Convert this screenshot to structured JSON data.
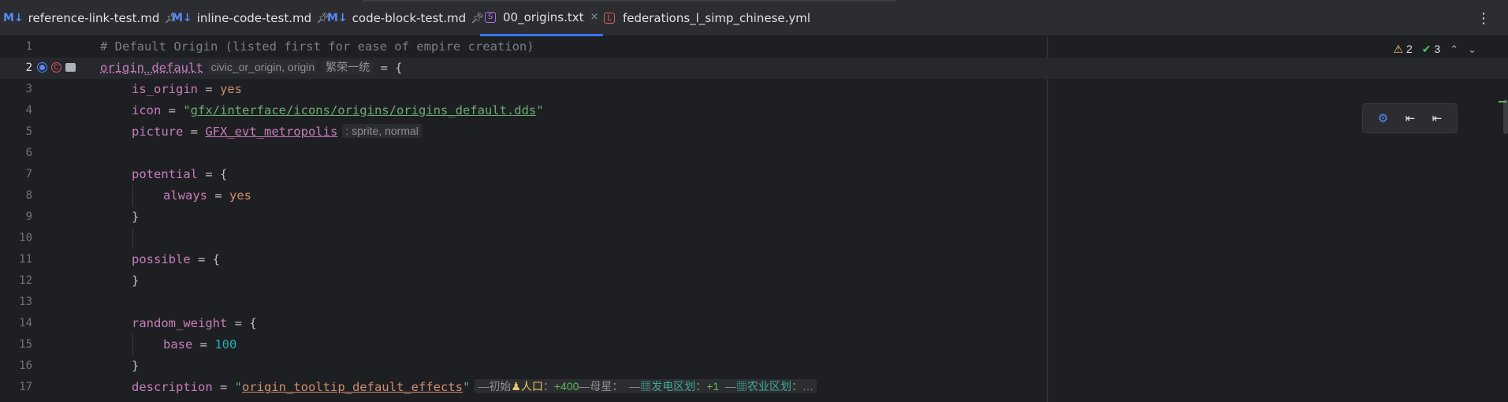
{
  "tabs": [
    {
      "icon": "M↓",
      "label": "reference-link-test.md",
      "pinned": true
    },
    {
      "icon": "M↓",
      "label": "inline-code-test.md",
      "pinned": true
    },
    {
      "icon": "M↓",
      "label": "code-block-test.md",
      "pinned": true
    },
    {
      "icon": "S",
      "label": "00_origins.txt",
      "active": true,
      "close": "×"
    },
    {
      "icon": "L",
      "label": "federations_l_simp_chinese.yml"
    }
  ],
  "more_menu": "⋮",
  "inspections": {
    "warnings": "2",
    "ok": "3",
    "up": "⌃",
    "down": "⌄"
  },
  "lines": {
    "l1": {
      "num": "1",
      "text": "# Default Origin (listed first for ease of empire creation)"
    },
    "l2": {
      "num": "2",
      "name": "origin_default",
      "hint_type": "civic_or_origin, origin",
      "hint_loc": "繁荣一统",
      "rest": " = {"
    },
    "l3": {
      "num": "3",
      "key": "is_origin",
      "op": " = ",
      "val": "yes"
    },
    "l4": {
      "num": "4",
      "key": "icon",
      "op": " = ",
      "q1": "\"",
      "path": "gfx/interface/icons/origins/origins_default.dds",
      "q2": "\""
    },
    "l5": {
      "num": "5",
      "key": "picture",
      "op": " = ",
      "val": "GFX_evt_metropolis",
      "hint": ": sprite, normal"
    },
    "l6": {
      "num": "6"
    },
    "l7": {
      "num": "7",
      "key": "potential",
      "op": " = {"
    },
    "l8": {
      "num": "8",
      "key": "always",
      "op": " = ",
      "val": "yes"
    },
    "l9": {
      "num": "9",
      "text": "}"
    },
    "l10": {
      "num": "10"
    },
    "l11": {
      "num": "11",
      "key": "possible",
      "op": " = {"
    },
    "l12": {
      "num": "12",
      "text": "}"
    },
    "l13": {
      "num": "13"
    },
    "l14": {
      "num": "14",
      "key": "random_weight",
      "op": " = {"
    },
    "l15": {
      "num": "15",
      "key": "base",
      "op": " = ",
      "val": "100"
    },
    "l16": {
      "num": "16",
      "text": "}"
    },
    "l17": {
      "num": "17",
      "key": "description",
      "op": " = ",
      "q1": "\"",
      "val": "origin_tooltip_default_effects",
      "q2": "\"",
      "hint_a": "—初始",
      "hint_b": "人口",
      "hint_c": "：",
      "hint_d": "+400",
      "hint_e": "—母星：  —",
      "hint_f": "发电区划",
      "hint_g": "：",
      "hint_h": "+1",
      "hint_i": "  —",
      "hint_j": "农业区划",
      "hint_k": "：…"
    }
  },
  "colors": {
    "accent": "#3574f0",
    "keyword": "#c77dbb",
    "value": "#cf8e6d",
    "number": "#2aacb8",
    "string": "#6aab73",
    "comment": "#7a7e85"
  }
}
